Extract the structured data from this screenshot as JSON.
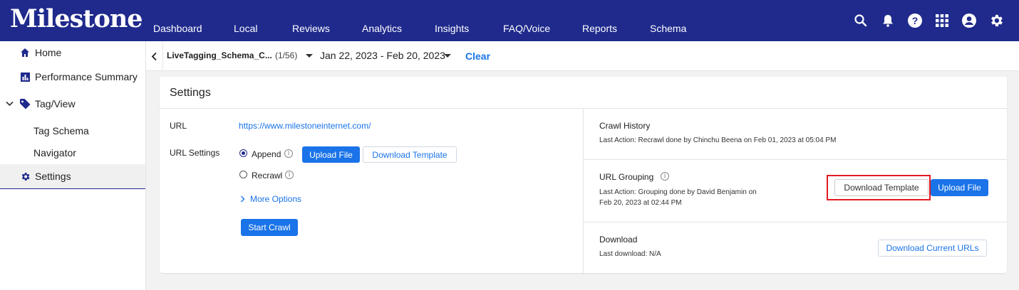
{
  "brand": {
    "logo": "Milestone"
  },
  "nav": {
    "items": [
      "Dashboard",
      "Local",
      "Reviews",
      "Analytics",
      "Insights",
      "FAQ/Voice",
      "Reports",
      "Schema"
    ],
    "icons": [
      "search-icon",
      "bell-icon",
      "help-icon",
      "apps-grid-icon",
      "account-icon",
      "gear-icon"
    ]
  },
  "sidebar": {
    "items": [
      {
        "label": "Home",
        "icon": "home-icon"
      },
      {
        "label": "Performance Summary",
        "icon": "bar-chart-icon"
      },
      {
        "label": "Tag/View",
        "icon": "tag-icon"
      },
      {
        "label": "Tag Schema"
      },
      {
        "label": "Navigator"
      },
      {
        "label": "Settings",
        "icon": "gear-icon",
        "active": true
      }
    ]
  },
  "filter": {
    "name": "LiveTagging_Schema_C...",
    "count": "(1/56)",
    "date_range": "Jan 22, 2023 - Feb 20, 2023",
    "clear": "Clear"
  },
  "settings": {
    "title": "Settings",
    "url_label": "URL",
    "url_value": "https://www.milestoneinternet.com/",
    "url_settings_label": "URL Settings",
    "append_label": "Append",
    "recrawl_label": "Recrawl",
    "upload_file": "Upload File",
    "download_template": "Download Template",
    "more_options": "More Options",
    "start_crawl": "Start Crawl"
  },
  "crawl_history": {
    "title": "Crawl History",
    "last_action": "Last Action: Recrawl done by Chinchu Beena on Feb 01, 2023 at 05:04 PM"
  },
  "url_grouping": {
    "title": "URL Grouping",
    "last_action_line1": "Last Action: Grouping done by David Benjamin on",
    "last_action_line2": "Feb 20, 2023 at 02:44 PM",
    "download_template": "Download Template",
    "upload_file": "Upload File"
  },
  "download": {
    "title": "Download",
    "last_download": "Last download: N/A",
    "button": "Download Current URLs"
  },
  "colors": {
    "nav_bg": "#1f2a8c",
    "accent": "#1a73e8",
    "highlight": "#e31b23"
  }
}
